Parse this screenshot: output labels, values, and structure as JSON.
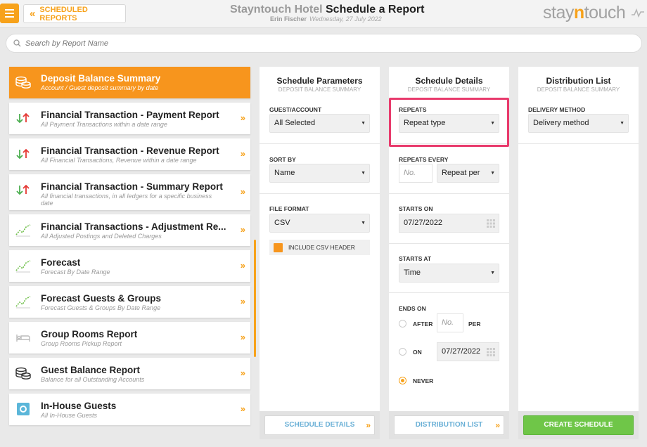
{
  "header": {
    "back_label": "SCHEDULED REPORTS",
    "hotel_name": "Stayntouch Hotel",
    "page_title": "Schedule a Report",
    "user_name": "Erin Fischer",
    "date": "Wednesday, 27 July 2022",
    "brand_prefix": "stay",
    "brand_mid": "n",
    "brand_suffix": "touch"
  },
  "search": {
    "placeholder": "Search by Report Name"
  },
  "reports": [
    {
      "title": "Deposit Balance Summary",
      "subtitle": "Account / Guest deposit summary by date",
      "icon": "coins-icon",
      "active": true
    },
    {
      "title": "Financial Transaction - Payment Report",
      "subtitle": "All Payment Transactions within a date range",
      "icon": "up-down-arrows-icon"
    },
    {
      "title": "Financial Transaction - Revenue Report",
      "subtitle": "All Financial Transactions, Revenue within a date range",
      "icon": "up-down-arrows-icon"
    },
    {
      "title": "Financial Transaction - Summary Report",
      "subtitle": "All financial transactions, in all ledgers for a specific business date",
      "icon": "up-down-arrows-icon"
    },
    {
      "title": "Financial Transactions - Adjustment Re...",
      "subtitle": "All Adjusted Postings and Deleted Charges",
      "icon": "trend-chart-icon"
    },
    {
      "title": "Forecast",
      "subtitle": "Forecast By Date Range",
      "icon": "trend-chart-icon"
    },
    {
      "title": "Forecast Guests & Groups",
      "subtitle": "Forecast Guests & Groups By Date Range",
      "icon": "trend-chart-icon"
    },
    {
      "title": "Group Rooms Report",
      "subtitle": "Group Rooms Pickup Report",
      "icon": "bed-icon"
    },
    {
      "title": "Guest Balance Report",
      "subtitle": "Balance for all Outstanding Accounts",
      "icon": "coins-icon"
    },
    {
      "title": "In-House Guests",
      "subtitle": "All In-House Guests",
      "icon": "in-house-icon"
    }
  ],
  "parameters": {
    "title": "Schedule Parameters",
    "subtitle": "DEPOSIT BALANCE SUMMARY",
    "guest_label": "GUEST/ACCOUNT",
    "guest_value": "All Selected",
    "sort_label": "SORT BY",
    "sort_value": "Name",
    "format_label": "FILE FORMAT",
    "format_value": "CSV",
    "csv_header_label": "INCLUDE CSV HEADER",
    "footer_button": "SCHEDULE DETAILS"
  },
  "details": {
    "title": "Schedule Details",
    "subtitle": "DEPOSIT BALANCE SUMMARY",
    "repeats_label": "REPEATS",
    "repeats_value": "Repeat type",
    "every_label": "REPEATS EVERY",
    "every_placeholder": "No.",
    "every_per": "Repeat per",
    "starts_on_label": "STARTS ON",
    "starts_on_value": "07/27/2022",
    "starts_at_label": "STARTS AT",
    "starts_at_value": "Time",
    "ends_on_label": "ENDS ON",
    "after_label": "AFTER",
    "after_placeholder": "No.",
    "per_label": "PER",
    "on_label": "ON",
    "on_value": "07/27/2022",
    "never_label": "NEVER",
    "footer_button": "DISTRIBUTION LIST"
  },
  "distribution": {
    "title": "Distribution List",
    "subtitle": "DEPOSIT BALANCE SUMMARY",
    "method_label": "DELIVERY METHOD",
    "method_value": "Delivery method",
    "footer_button": "CREATE SCHEDULE"
  },
  "colors": {
    "accent": "#f7951d",
    "highlight": "#e83a6c",
    "create": "#6fc648",
    "link": "#6ab0d6"
  }
}
